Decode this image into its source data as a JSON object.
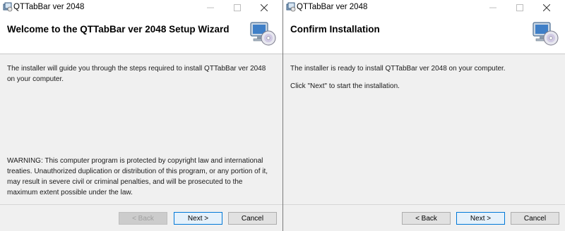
{
  "left_window": {
    "title": "QTTabBar ver 2048",
    "heading": "Welcome to the QTTabBar ver 2048 Setup Wizard",
    "intro": "The installer will guide you through the steps required to install QTTabBar ver 2048 on your computer.",
    "warning": "WARNING: This computer program is protected by copyright law and international treaties. Unauthorized duplication or distribution of this program, or any portion of it, may result in severe civil or criminal penalties, and will be prosecuted to the maximum extent possible under the law.",
    "buttons": {
      "back": "< Back",
      "next": "Next >",
      "cancel": "Cancel"
    }
  },
  "right_window": {
    "title": "QTTabBar ver 2048",
    "heading": "Confirm Installation",
    "line1": "The installer is ready to install QTTabBar ver 2048 on your computer.",
    "line2": "Click \"Next\" to start the installation.",
    "buttons": {
      "back": "< Back",
      "next": "Next >",
      "cancel": "Cancel"
    }
  },
  "icons": {
    "app": "installer-app-icon",
    "banner": "computer-cd-icon",
    "minimize": "minimize-icon",
    "maximize": "maximize-icon",
    "close": "close-icon"
  },
  "colors": {
    "default_button_border": "#0078d7",
    "dialog_background": "#f0f0f0",
    "banner_background": "#ffffff"
  }
}
